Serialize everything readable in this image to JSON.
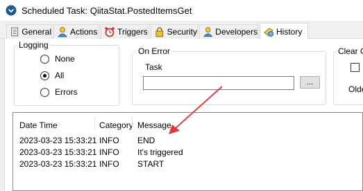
{
  "window": {
    "title": "Scheduled Task: QiitaStat.PostedItemsGet"
  },
  "tabs": [
    {
      "label": "General",
      "icon": "document-icon"
    },
    {
      "label": "Actions",
      "icon": "person-icon"
    },
    {
      "label": "Triggers",
      "icon": "alarm-clock-icon"
    },
    {
      "label": "Security",
      "icon": "lock-icon"
    },
    {
      "label": "Developers",
      "icon": "person-icon"
    },
    {
      "label": "History",
      "icon": "history-icon",
      "active": true
    }
  ],
  "logging": {
    "label": "Logging",
    "options": [
      {
        "label": "None",
        "selected": false
      },
      {
        "label": "All",
        "selected": true
      },
      {
        "label": "Errors",
        "selected": false
      }
    ]
  },
  "on_error": {
    "label": "On Error",
    "task_label": "Task",
    "task_value": "",
    "browse_label": "..."
  },
  "clear_options": {
    "label": "Clear Op",
    "older_label": "Olde"
  },
  "history_table": {
    "columns": [
      "Date Time",
      "Category",
      "Message"
    ],
    "rows": [
      [
        "2023-03-23 15:33:21",
        "INFO",
        "END"
      ],
      [
        "2023-03-23 15:33:21",
        "INFO",
        "It's triggered"
      ],
      [
        "2023-03-23 15:33:21",
        "INFO",
        "START"
      ]
    ]
  },
  "annotation": {
    "arrow_color": "#e0393e"
  }
}
